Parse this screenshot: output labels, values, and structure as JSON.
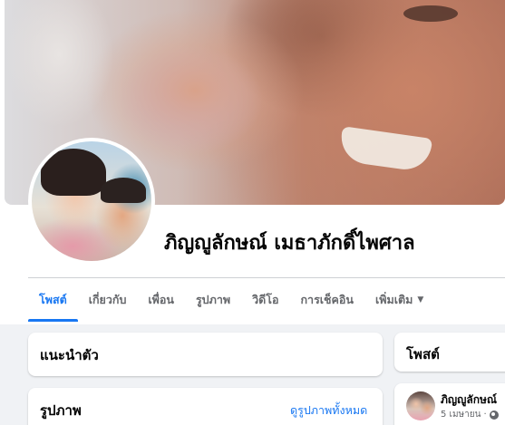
{
  "profile": {
    "name": "ภิญญูลักษณ์ เมธาภักดิ์ไพศาล"
  },
  "tabs": [
    {
      "label": "โพสต์",
      "active": true
    },
    {
      "label": "เกี่ยวกับ"
    },
    {
      "label": "เพื่อน"
    },
    {
      "label": "รูปภาพ"
    },
    {
      "label": "วิดีโอ"
    },
    {
      "label": "การเช็คอิน"
    },
    {
      "label": "เพิ่มเติม",
      "icon": "caret-down-icon"
    }
  ],
  "intro": {
    "title": "แนะนำตัว"
  },
  "photos": {
    "title": "รูปภาพ",
    "see_all": "ดูรูปภาพทั้งหมด"
  },
  "posts": {
    "title": "โพสต์"
  },
  "post": {
    "author": "ภิญญูลักษณ์",
    "date": "5 เมษายน",
    "separator": "·",
    "privacy_icon": "globe-icon"
  },
  "colors": {
    "accent": "#1877f2",
    "background": "#f0f2f5",
    "text_secondary": "#65676b"
  }
}
